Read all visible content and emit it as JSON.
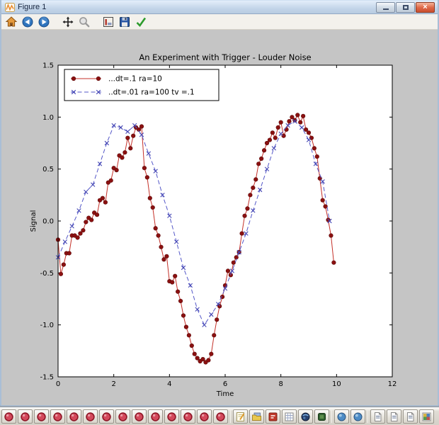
{
  "window": {
    "title": "Figure 1",
    "controls": [
      {
        "name": "minimize"
      },
      {
        "name": "maximize"
      },
      {
        "name": "close",
        "glyph": "x"
      }
    ]
  },
  "toolbar": {
    "buttons": [
      {
        "icon": "home"
      },
      {
        "icon": "back"
      },
      {
        "icon": "forward"
      },
      {
        "icon": "pan"
      },
      {
        "icon": "zoom"
      },
      {
        "icon": "subplots"
      },
      {
        "icon": "save"
      },
      {
        "icon": "check"
      }
    ]
  },
  "chart_data": {
    "type": "line",
    "title": "An Experiment with Trigger - Louder Noise",
    "xlabel": "Time",
    "ylabel": "Signal",
    "xlim": [
      0,
      12
    ],
    "ylim": [
      -1.5,
      1.5
    ],
    "xticks": [
      0,
      2,
      4,
      6,
      8,
      10,
      12
    ],
    "yticks": [
      -1.5,
      -1.0,
      -0.5,
      0.0,
      0.5,
      1.0,
      1.5
    ],
    "grid": false,
    "legend_position": "upper left",
    "series": [
      {
        "name": "...dt=.1 ra=10",
        "line_style": "solid",
        "marker": "circle",
        "line_color": "#c43028",
        "marker_color": "#8b1010",
        "x_start": 0,
        "dt": 0.1,
        "y": [
          -0.18,
          -0.51,
          -0.42,
          -0.31,
          -0.31,
          -0.14,
          -0.14,
          -0.16,
          -0.12,
          -0.09,
          -0.01,
          0.03,
          0.01,
          0.08,
          0.06,
          0.2,
          0.22,
          0.18,
          0.37,
          0.39,
          0.51,
          0.49,
          0.63,
          0.61,
          0.66,
          0.8,
          0.7,
          0.82,
          0.9,
          0.88,
          0.91,
          0.51,
          0.42,
          0.22,
          0.13,
          -0.07,
          -0.14,
          -0.25,
          -0.37,
          -0.34,
          -0.58,
          -0.59,
          -0.53,
          -0.68,
          -0.77,
          -0.91,
          -1.02,
          -1.1,
          -1.2,
          -1.28,
          -1.32,
          -1.35,
          -1.33,
          -1.36,
          -1.34,
          -1.28,
          -1.1,
          -0.95,
          -0.82,
          -0.73,
          -0.62,
          -0.48,
          -0.52,
          -0.4,
          -0.35,
          -0.3,
          -0.12,
          0.05,
          0.12,
          0.25,
          0.32,
          0.4,
          0.55,
          0.6,
          0.68,
          0.75,
          0.78,
          0.85,
          0.8,
          0.9,
          0.95,
          0.82,
          0.88,
          0.96,
          1.0,
          0.97,
          1.02,
          0.95,
          1.01,
          0.88,
          0.85,
          0.8,
          0.7,
          0.62,
          0.41,
          0.2,
          0.14,
          0.01,
          -0.14,
          -0.4
        ]
      },
      {
        "name": "..dt=.01 ra=100 tv =.1",
        "line_style": "dashed",
        "marker": "x",
        "line_color": "#5558c8",
        "marker_color": "#4446b4",
        "x_start": 0,
        "dt": 0.25,
        "y": [
          -0.35,
          -0.2,
          -0.05,
          0.1,
          0.28,
          0.35,
          0.55,
          0.75,
          0.92,
          0.9,
          0.86,
          0.92,
          0.83,
          0.65,
          0.48,
          0.25,
          0.05,
          -0.2,
          -0.45,
          -0.62,
          -0.85,
          -1.0,
          -0.9,
          -0.8,
          -0.65,
          -0.48,
          -0.3,
          -0.12,
          0.1,
          0.3,
          0.5,
          0.7,
          0.84,
          0.92,
          0.96,
          0.9,
          0.78,
          0.55,
          0.38,
          0.0
        ]
      }
    ]
  },
  "taskbar": {
    "buttons": [
      {
        "icon": "red-dot"
      },
      {
        "icon": "red-dot"
      },
      {
        "icon": "red-dot"
      },
      {
        "icon": "red-dot"
      },
      {
        "icon": "red-dot"
      },
      {
        "icon": "red-dot"
      },
      {
        "icon": "red-dot"
      },
      {
        "icon": "red-dot"
      },
      {
        "icon": "red-dot"
      },
      {
        "icon": "red-dot"
      },
      {
        "icon": "red-dot"
      },
      {
        "icon": "red-dot"
      },
      {
        "icon": "red-dot"
      },
      {
        "icon": "red-dot"
      },
      {
        "icon": "notepad"
      },
      {
        "icon": "folder"
      },
      {
        "icon": "pdf"
      },
      {
        "icon": "grid"
      },
      {
        "icon": "globe"
      },
      {
        "icon": "green-app"
      },
      {
        "icon": "blue-sphere"
      },
      {
        "icon": "blue-sphere"
      },
      {
        "icon": "document"
      },
      {
        "icon": "document"
      },
      {
        "icon": "document"
      },
      {
        "icon": "photos"
      }
    ],
    "separators_after_index": [
      13,
      19,
      21
    ]
  }
}
